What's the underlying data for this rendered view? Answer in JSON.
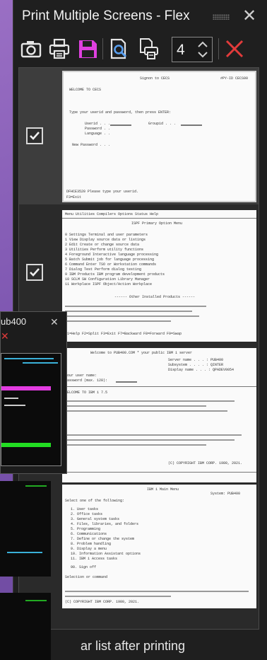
{
  "window": {
    "title": "Print Multiple Screens - Flex",
    "close_glyph": "✕"
  },
  "toolbar": {
    "icons": [
      "camera-icon",
      "printer-icon",
      "save-icon",
      "print-preview-icon",
      "print-setup-icon"
    ],
    "copies_value": "4",
    "delete_icon": "delete-icon",
    "accent_save": "#e040e0",
    "accent_delete": "#e23b3b",
    "accent_preview": "#5aa0f0"
  },
  "screens": [
    {
      "checked": true,
      "selected": true,
      "header_left": "Signon to CECS",
      "header_right": "#PY-ID CECS00",
      "welcome": "WELCOME TO CECS",
      "prompt": "Type your userid and password, then press ENTER:",
      "fields": [
        "Userid . . .",
        "Password . .",
        "Language . .",
        "New Password . . ."
      ],
      "groupid": "Groupid . . .",
      "message": "DFHCE3520 Please type your userid.",
      "function_key": "F3=Exit"
    },
    {
      "checked": true,
      "selected": false,
      "menubar": "Menu  Utilities  Compilers  Options  Status  Help",
      "heading": "ISPF Primary Option Menu",
      "options": [
        "0 Settings     Terminal and user parameters",
        "1 View         Display source data or listings",
        "2 Edit         Create or change source data",
        "3 Utilities    Perform utility functions",
        "4 Foreground   Interactive language processing",
        "5 Batch        Submit job for language processing",
        "6 Command      Enter TSO or Workstation commands",
        "7 Dialog Test  Perform dialog testing",
        "9 IBM Products IBM program development products",
        "10 SCLM        SW Configuration Library Manager",
        "11 Workplace   ISPF Object/Action Workplace"
      ],
      "other_products": "------ Other Installed Products ------",
      "fkeys": "F1=Help  F2=Split  F3=Exit  F7=Backward  F8=Forward  F9=Swap"
    },
    {
      "checked": false,
      "selected": false,
      "line1": "Welcome to PUB400.COM * your public IBM i server",
      "server_name": "Server name . . . :  PUB400",
      "subsystem": "Subsystem . . . . :  QINTER",
      "display_name": "Display name . . . :  QPADEV0054",
      "user": "Your user name:",
      "password": "Password (max. 128):",
      "welcome_line": "WELCOME TO IBM i 7.5",
      "footer": "(C) COPYRIGHT IBM CORP. 1980, 2021."
    },
    {
      "checked": false,
      "selected": false,
      "heading": "IBM i Main Menu",
      "system": "System: PUB400",
      "select": "Select one of the following:",
      "options": [
        "1. User tasks",
        "2. Office tasks",
        "3. General system tasks",
        "4. Files, libraries, and folders",
        "5. Programming",
        "6. Communications",
        "7. Define or change the system",
        "8. Problem handling",
        "9. Display a menu",
        "10. Information Assistant options",
        "11. IBM i Access tasks",
        "90. Sign off"
      ],
      "selection": "Selection or command",
      "footer": "(C) COPYRIGHT IBM CORP. 1980, 2021."
    }
  ],
  "footer": {
    "label": "ar list after printing"
  },
  "overlay_window": {
    "title": "ub400",
    "close_glyph": "✕",
    "accent_magenta": "#e23be0",
    "accent_green": "#22dd22",
    "accent_cyan": "#3ab0d8"
  }
}
